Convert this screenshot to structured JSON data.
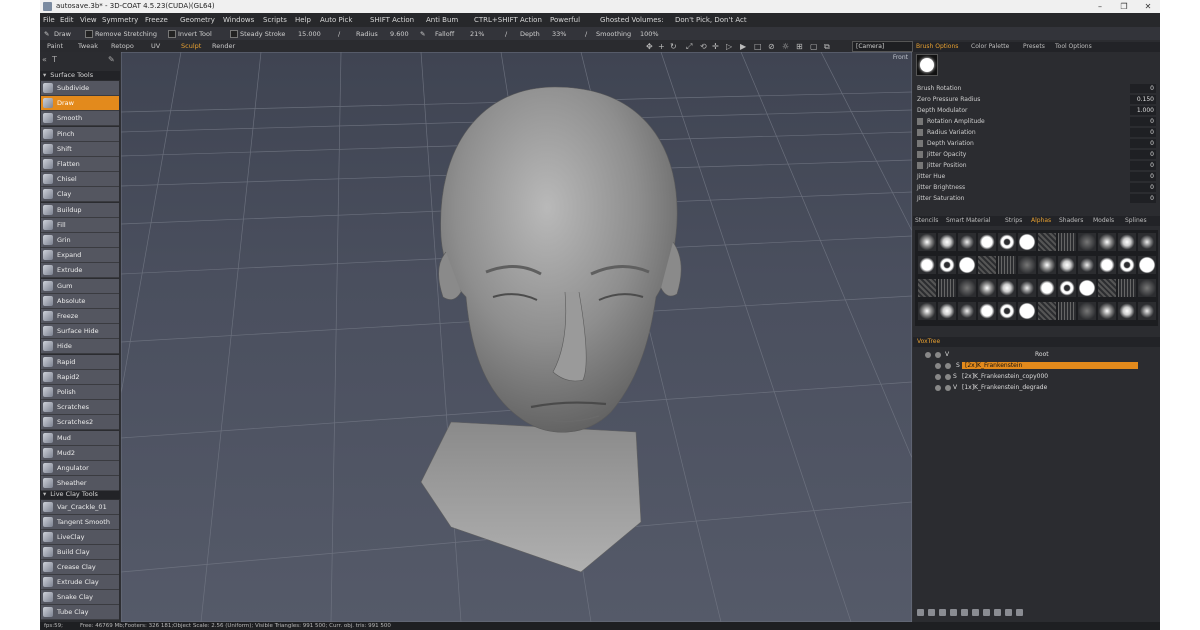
{
  "window": {
    "title": "autosave.3b* - 3D-COAT 4.5.23(CUDA)(GL64)",
    "minimize": "–",
    "maximize": "❐",
    "close": "✕"
  },
  "menu": {
    "items": [
      "File",
      "Edit",
      "View",
      "Symmetry",
      "Freeze",
      "Geometry",
      "Windows",
      "Scripts",
      "Help"
    ],
    "auto_pick": "Auto Pick",
    "shift_action": "SHIFT Action",
    "shift_value": "Anti Bum",
    "ctrl_shift_action": "CTRL+SHIFT Action",
    "ctrl_shift_value": "Powerful",
    "ghosted": "Ghosted Volumes:",
    "ghosted_value": "Don't Pick, Don't Act"
  },
  "options": {
    "tool": "Draw",
    "remove_stretching": "Remove Stretching",
    "invert_tool": "Invert Tool",
    "steady_stroke": "Steady Stroke",
    "steady_value": "15.000",
    "radius": "Radius",
    "radius_value": "9.600",
    "falloff": "Falloff",
    "falloff_value": "21%",
    "depth": "Depth",
    "depth_value": "33%",
    "smoothing": "Smoothing",
    "smoothing_value": "100%"
  },
  "rooms": {
    "tabs": [
      "Paint",
      "Tweak",
      "Retopo",
      "UV",
      "Sculpt",
      "Render"
    ],
    "active": "Sculpt"
  },
  "camera": "[Camera]",
  "viewport": {
    "view_label": "Front"
  },
  "left": {
    "surface_section": "Surface Tools",
    "surface_tools": [
      "Subdivide",
      "Draw",
      "Smooth",
      "Pinch",
      "Shift",
      "Flatten",
      "Chisel",
      "Clay",
      "Buildup",
      "Fill",
      "Grin",
      "Expand",
      "Extrude",
      "Gum",
      "Absolute",
      "Freeze",
      "Surface Hide",
      "Hide",
      "Rapid",
      "Rapid2",
      "Polish",
      "Scratches",
      "Scratches2",
      "Mud",
      "Mud2",
      "Angulator",
      "Sheather"
    ],
    "active_tool": "Draw",
    "live_clay_section": "Live Clay Tools",
    "live_clay_tools": [
      "Var_Crackle_01",
      "Tangent Smooth",
      "LiveClay",
      "Build Clay",
      "Crease Clay",
      "Extrude Clay",
      "Snake Clay",
      "Tube Clay"
    ]
  },
  "right": {
    "tabs": [
      "Brush Options",
      "Color Palette",
      "Presets",
      "Tool Options"
    ],
    "properties": [
      {
        "label": "Brush Rotation",
        "value": "0"
      },
      {
        "label": "Zero Pressure Radius",
        "value": "0.150"
      },
      {
        "label": "Depth Modulator",
        "value": "1.000"
      },
      {
        "label": "Rotation Amplitude",
        "value": "0"
      },
      {
        "label": "Radius Variation",
        "value": "0"
      },
      {
        "label": "Depth Variation",
        "value": "0"
      },
      {
        "label": "Jitter Opacity",
        "value": "0"
      },
      {
        "label": "Jitter Position",
        "value": "0"
      },
      {
        "label": "Jitter Hue",
        "value": "0"
      },
      {
        "label": "Jitter Brightness",
        "value": "0"
      },
      {
        "label": "Jitter Saturation",
        "value": "0"
      }
    ],
    "library_tabs": [
      "Stencils",
      "Smart Material",
      "Strips",
      "Alphas",
      "Shaders",
      "Models",
      "Splines"
    ],
    "library_active": "Alphas",
    "voxtree_tab": "VoxTree",
    "layers": [
      {
        "kind": "V",
        "name": "Root"
      },
      {
        "kind": "S",
        "name": "[2x]K_Frankenstein",
        "selected": true
      },
      {
        "kind": "S",
        "name": "[2x]K_Frankenstein_copy000"
      },
      {
        "kind": "V",
        "name": "[1x]K_Frankenstein_degrade"
      }
    ]
  },
  "status": {
    "fps": "fps:59;",
    "memory": "Free: 46769 Mb;Footers: 326 181;Object Scale: 2.56 (Uniform); Visible Triangles: 991 500; Curr. obj. tris: 991 500"
  }
}
